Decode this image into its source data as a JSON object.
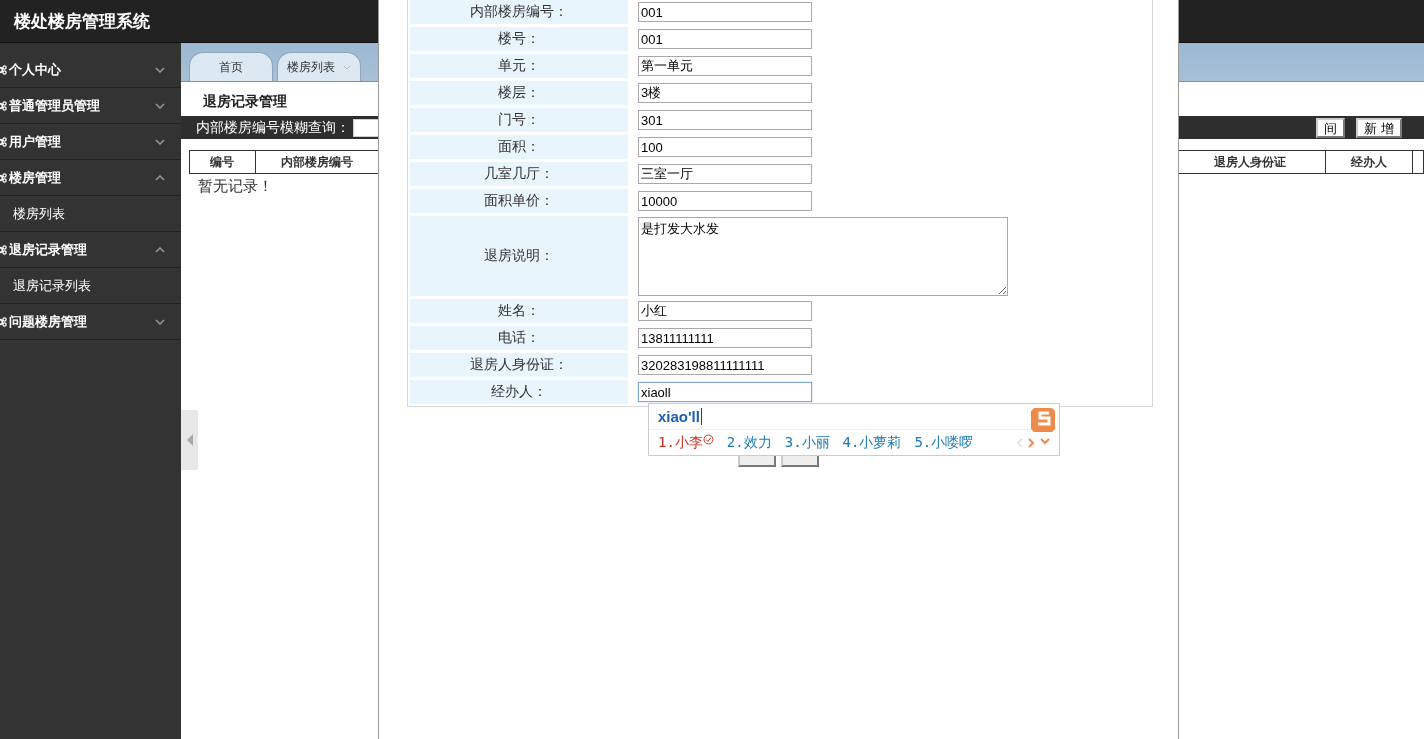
{
  "header": {
    "title": "楼处楼房管理系统"
  },
  "sidebar": {
    "items": [
      {
        "label": "个人中心",
        "expanded": false
      },
      {
        "label": "普通管理员管理",
        "expanded": false
      },
      {
        "label": "用户管理",
        "expanded": false
      },
      {
        "label": "楼房管理",
        "expanded": true,
        "children": [
          {
            "label": "楼房列表"
          }
        ]
      },
      {
        "label": "退房记录管理",
        "expanded": true,
        "children": [
          {
            "label": "退房记录列表"
          }
        ]
      },
      {
        "label": "问题楼房管理",
        "expanded": false
      }
    ]
  },
  "tabs": [
    {
      "label": "首页",
      "selected": false
    },
    {
      "label": "楼房列表",
      "selected": false
    }
  ],
  "page": {
    "title": "退房记录管理",
    "search_label": "内部楼房编号模糊查询：",
    "search_button": "间",
    "add_button": "新 增",
    "columns": [
      {
        "label": "编号",
        "kind": "left"
      },
      {
        "label": "内部楼房编号",
        "kind": "left"
      },
      {
        "label": "退房人身份证",
        "kind": "right"
      },
      {
        "label": "经办人",
        "kind": "right"
      }
    ],
    "empty_message": "暂无记录！"
  },
  "dialog": {
    "fields": [
      {
        "label": "内部楼房编号：",
        "value": "001",
        "kind": "text",
        "focused": false
      },
      {
        "label": "楼号：",
        "value": "001",
        "kind": "text",
        "focused": false
      },
      {
        "label": "单元：",
        "value": "第一单元",
        "kind": "text",
        "focused": false
      },
      {
        "label": "楼层：",
        "value": "3楼",
        "kind": "text",
        "focused": false
      },
      {
        "label": "门号：",
        "value": "301",
        "kind": "text",
        "focused": false
      },
      {
        "label": "面积：",
        "value": "100",
        "kind": "text",
        "focused": false
      },
      {
        "label": "几室几厅：",
        "value": "三室一厅",
        "kind": "text",
        "focused": false
      },
      {
        "label": "面积单价：",
        "value": "10000",
        "kind": "text",
        "focused": false
      },
      {
        "label": "退房说明：",
        "value": "是打发大水发",
        "kind": "textarea",
        "focused": false
      },
      {
        "label": "姓名：",
        "value": "小红",
        "kind": "text",
        "focused": false
      },
      {
        "label": "电话：",
        "value": "13811111111",
        "kind": "text",
        "focused": false
      },
      {
        "label": "退房人身份证：",
        "value": "320283198811111111",
        "kind": "text",
        "focused": false
      },
      {
        "label": "经办人：",
        "value": "xiaoll",
        "kind": "text",
        "focused": true
      }
    ]
  },
  "ime": {
    "composition": "xiao'll",
    "candidates": [
      {
        "label": "1.小李",
        "selected": true
      },
      {
        "label": "2.效力",
        "selected": false
      },
      {
        "label": "3.小丽",
        "selected": false
      },
      {
        "label": "4.小萝莉",
        "selected": false
      },
      {
        "label": "5.小喽啰",
        "selected": false
      }
    ]
  }
}
